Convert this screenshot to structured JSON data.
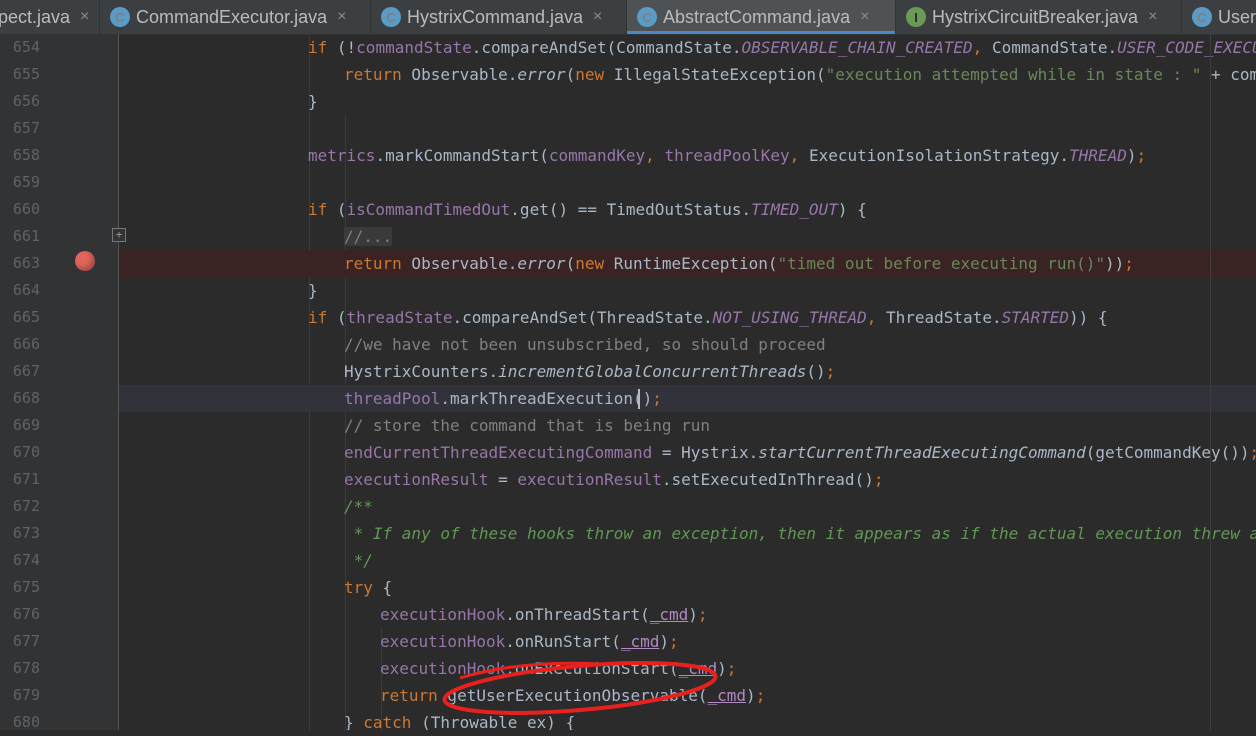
{
  "tabs": [
    {
      "label": "pect.java",
      "icon": "",
      "active": false
    },
    {
      "label": "CommandExecutor.java",
      "icon": "class-icon",
      "active": false
    },
    {
      "label": "HystrixCommand.java",
      "icon": "class-icon",
      "active": false
    },
    {
      "label": "AbstractCommand.java",
      "icon": "class-icon",
      "active": true
    },
    {
      "label": "HystrixCircuitBreaker.java",
      "icon": "interface-icon",
      "active": false
    },
    {
      "label": "User",
      "icon": "class-icon",
      "active": false
    }
  ],
  "close_glyph": "×",
  "tab_icon_letters": {
    "class": "C",
    "interface": "I"
  },
  "fold_glyph": "+",
  "line_numbers": [
    "654",
    "655",
    "656",
    "657",
    "658",
    "659",
    "660",
    "661",
    "663",
    "664",
    "665",
    "666",
    "667",
    "668",
    "669",
    "670",
    "671",
    "672",
    "673",
    "674",
    "675",
    "676",
    "677",
    "678",
    "679",
    "680"
  ],
  "code": [
    "if (!commandState.compareAndSet(CommandState.OBSERVABLE_CHAIN_CREATED, CommandState.USER_CODE_EXECUTED))",
    "return Observable.error(new IllegalStateException(\"execution attempted while in state : \" + commandSta",
    "}",
    "",
    "metrics.markCommandStart(commandKey, threadPoolKey, ExecutionIsolationStrategy.THREAD);",
    "",
    "if (isCommandTimedOut.get() == TimedOutStatus.TIMED_OUT) {",
    "//...",
    "return Observable.error(new RuntimeException(\"timed out before executing run()\"));",
    "}",
    "if (threadState.compareAndSet(ThreadState.NOT_USING_THREAD, ThreadState.STARTED)) {",
    "//we have not been unsubscribed, so should proceed",
    "HystrixCounters.incrementGlobalConcurrentThreads();",
    "threadPool.markThreadExecution();",
    "// store the command that is being run",
    "endCurrentThreadExecutingCommand = Hystrix.startCurrentThreadExecutingCommand(getCommandKey());",
    "executionResult = executionResult.setExecutedInThread();",
    "/**",
    " * If any of these hooks throw an exception, then it appears as if the actual execution threw an erro",
    " */",
    "try {",
    "executionHook.onThreadStart(_cmd);",
    "executionHook.onRunStart(_cmd);",
    "executionHook.onExecutionStart(_cmd);",
    "return getUserExecutionObservable(_cmd);",
    "} catch (Throwable ex) {"
  ],
  "colors": {
    "background": "#2b2b2b",
    "keyword": "#cc7832",
    "field": "#9876aa",
    "string": "#6a8759",
    "comment": "#808080",
    "doc_comment": "#629755",
    "breakpoint": "#e0655a",
    "annotation_ellipse": "#e8201e"
  }
}
